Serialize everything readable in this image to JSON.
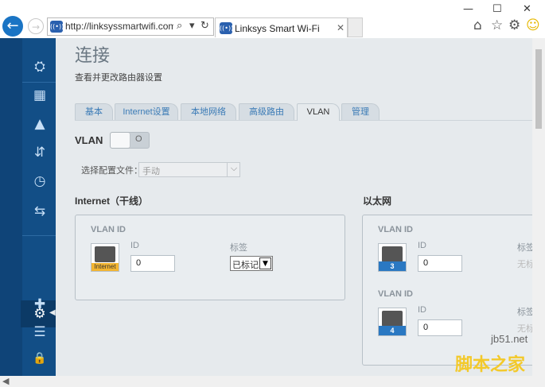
{
  "browser": {
    "url": "http://linksyssmartwifi.com/(",
    "tab_title": "Linksys Smart Wi-Fi",
    "wifi_badge": "((•))",
    "back_glyph": "←",
    "forward_glyph": "→",
    "search_glyph": "⌕",
    "dropdown_glyph": "▾",
    "refresh_glyph": "↻",
    "close_glyph": "✕",
    "window": {
      "minimize": "—",
      "maximize": "☐",
      "close": "✕"
    },
    "tools": {
      "home": "⌂",
      "favorites": "☆",
      "settings": "⚙",
      "smiley": "☺"
    }
  },
  "sidebar": {
    "items": [
      {
        "name": "network-map-icon",
        "glyph": "⛭"
      },
      {
        "name": "devices-icon",
        "glyph": "▦"
      },
      {
        "name": "alert-icon",
        "glyph": "▲"
      },
      {
        "name": "connectivity-icon",
        "glyph": "⇵"
      },
      {
        "name": "speed-icon",
        "glyph": "◷"
      },
      {
        "name": "usb-icon",
        "glyph": "⇆"
      },
      {
        "name": "settings-icon",
        "glyph": "⚙"
      },
      {
        "name": "troubleshoot-icon",
        "glyph": "✚"
      },
      {
        "name": "wireless-icon",
        "glyph": "☰"
      },
      {
        "name": "security-icon",
        "glyph": "🔒"
      }
    ],
    "active_arrow": "◀"
  },
  "page": {
    "title": "连接",
    "subtitle": "查看并更改路由器设置"
  },
  "tabs": [
    {
      "label": "基本"
    },
    {
      "label": "Internet设置"
    },
    {
      "label": "本地网络"
    },
    {
      "label": "高级路由"
    },
    {
      "label": "VLAN",
      "active": true
    },
    {
      "label": "管理"
    }
  ],
  "vlan": {
    "label": "VLAN",
    "toggle_text": "O",
    "enabled": false
  },
  "profile": {
    "label": "选择配置文件：",
    "value": "手动",
    "arrow": "⌵"
  },
  "internet_section": {
    "title": "Internet（干线）",
    "vlan_id_label": "VLAN ID",
    "id_label": "ID",
    "id_value": "0",
    "tag_label": "标签",
    "tag_value": "已标记",
    "tag_arrow": "▼",
    "port_label": "Internet"
  },
  "ethernet_section": {
    "title": "以太网",
    "ports": [
      {
        "vlan_id_label": "VLAN ID",
        "id_label": "ID",
        "id_value": "0",
        "tag_label": "标签",
        "tag_value": "无标",
        "port_number": "3"
      },
      {
        "vlan_id_label": "VLAN ID",
        "id_label": "ID",
        "id_value": "0",
        "tag_label": "标签",
        "tag_value": "无标",
        "port_number": "4"
      }
    ]
  },
  "watermark": {
    "url": "jb51.net",
    "text": "脚本之家"
  },
  "colors": {
    "sidebar_bg": "#124e86",
    "accent_blue": "#2a78c2",
    "internet_port": "#f3b531",
    "main_bg": "#e6eaed"
  }
}
